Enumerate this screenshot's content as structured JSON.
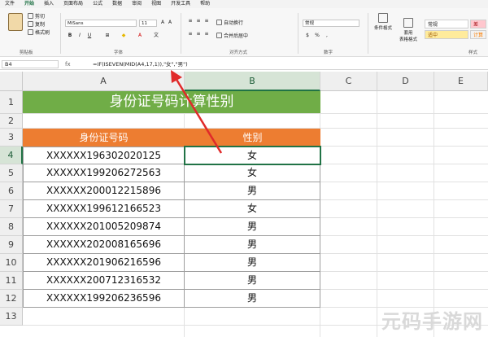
{
  "menu": [
    "文件",
    "开始",
    "插入",
    "页面布局",
    "公式",
    "数据",
    "审阅",
    "视图",
    "开发工具",
    "帮助"
  ],
  "menu_active_index": 1,
  "ribbon": {
    "clipboard": {
      "cut": "剪切",
      "copy": "复制",
      "format_painter": "格式刷",
      "label": "剪贴板"
    },
    "font": {
      "name": "MiSans",
      "size": "11",
      "label": "字体"
    },
    "alignment": {
      "wrap": "自动换行",
      "merge": "合并后居中",
      "label": "对齐方式"
    },
    "number": {
      "format": "常规",
      "label": "数字"
    },
    "styles": {
      "conditional": "条件格式",
      "table": "套用\n表格格式",
      "normal": "常规",
      "neutral": "适中",
      "bad": "差",
      "calc": "计算",
      "label": "样式"
    }
  },
  "formula_bar": {
    "cell_ref": "B4",
    "fx": "fx",
    "formula": "=IF(ISEVEN(MID(A4,17,1)),\"女\",\"男\")"
  },
  "columns": [
    "A",
    "B",
    "C",
    "D",
    "E"
  ],
  "rows": [
    "1",
    "2",
    "3",
    "4",
    "5",
    "6",
    "7",
    "8",
    "9",
    "10",
    "11",
    "12",
    "13"
  ],
  "sheet": {
    "title": "身份证号码计算性别",
    "header_id": "身份证号码",
    "header_gender": "性别",
    "records": [
      {
        "id": "XXXXXX196302020125",
        "gender": "女"
      },
      {
        "id": "XXXXXX199206272563",
        "gender": "女"
      },
      {
        "id": "XXXXXX200012215896",
        "gender": "男"
      },
      {
        "id": "XXXXXX199612166523",
        "gender": "女"
      },
      {
        "id": "XXXXXX201005209874",
        "gender": "男"
      },
      {
        "id": "XXXXXX202008165696",
        "gender": "男"
      },
      {
        "id": "XXXXXX201906216596",
        "gender": "男"
      },
      {
        "id": "XXXXXX200712316532",
        "gender": "男"
      },
      {
        "id": "XXXXXX199206236596",
        "gender": "男"
      }
    ]
  },
  "watermark": "元码手游网",
  "colors": {
    "title_bg": "#70ad47",
    "header_bg": "#ed7d31",
    "arrow": "#e02a2a",
    "accent": "#217346"
  }
}
